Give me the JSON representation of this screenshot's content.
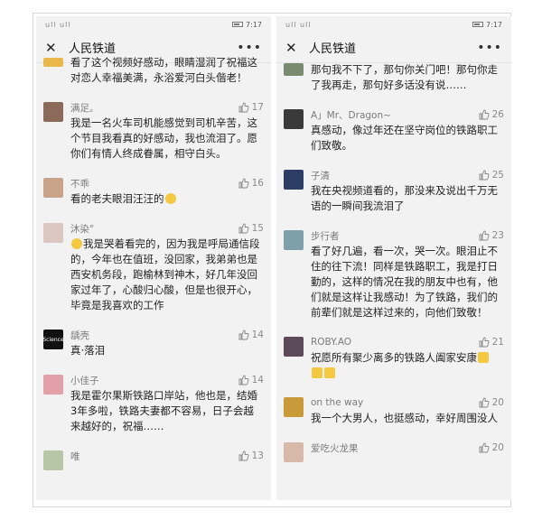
{
  "statusbar": {
    "signal": "ull ull",
    "time": "7:17"
  },
  "left": {
    "title": "人民铁道",
    "comments": [
      {
        "name": "",
        "likes": "",
        "text": "看了这个视频好感动，眼睛湿润了祝福这对恋人幸福美满，永浴爱河白头偕老！"
      },
      {
        "name": "满足。",
        "likes": "17",
        "text": "我是一名火车司机能感觉到司机辛苦，这个节目我看真的好感动，我也流泪了。愿你们有情人终成眷属，相守白头。"
      },
      {
        "name": "不乖",
        "likes": "16",
        "text": "看的老夫眼泪汪汪的"
      },
      {
        "name": "沐染°",
        "likes": "15",
        "text": "我是哭着看完的，因为我是呼局通信段的，今年也在值班，没回家，我弟弟也是西安机务段，跑榆林到神木，好几年没回家过年了，心酸归心酸，但是也很开心，毕竟是我喜欢的工作"
      },
      {
        "name": "龋壳",
        "likes": "14",
        "text": "真·落泪"
      },
      {
        "name": "小佳子",
        "likes": "14",
        "text": "我是霍尔果斯铁路口岸站，他也是，结婚3年多啦，铁路夫妻都不容易，日子会越来越好的，祝福……"
      },
      {
        "name": "唯",
        "likes": "13",
        "text": ""
      }
    ]
  },
  "right": {
    "title": "人民铁道",
    "comments": [
      {
        "name": "",
        "likes": "",
        "text": "那句我不下了，那句你关门吧！那句你走了我再走，那句好多话没有说……"
      },
      {
        "name": "A」Mr、Dragon~",
        "likes": "26",
        "text": "真感动，像过年还在坚守岗位的铁路职工们致敬。"
      },
      {
        "name": "子清",
        "likes": "25",
        "text": "我在央视频道看的，那没来及说出千万无语的一瞬间我流泪了"
      },
      {
        "name": "步行者",
        "likes": "23",
        "text": "看了好几遍，看一次，哭一次。眼泪止不住的往下流！同样是铁路职工，我是打日勤的，这样的情况在我的朋友中也有，他们就是这样让我感动！为了铁路，我们的前辈们就是这样过来的，向他们致敬！"
      },
      {
        "name": "ROBY.AO",
        "likes": "21",
        "text": "祝愿所有聚少离多的铁路人阖家安康"
      },
      {
        "name": "on the way",
        "likes": "20",
        "text": "我一个大男人，也挺感动，幸好周围没人"
      },
      {
        "name": "爱吃火龙果",
        "likes": "20",
        "text": ""
      }
    ]
  },
  "icons": {
    "close": "close-icon",
    "more": "more-icon",
    "like": "thumbs-up-icon"
  }
}
